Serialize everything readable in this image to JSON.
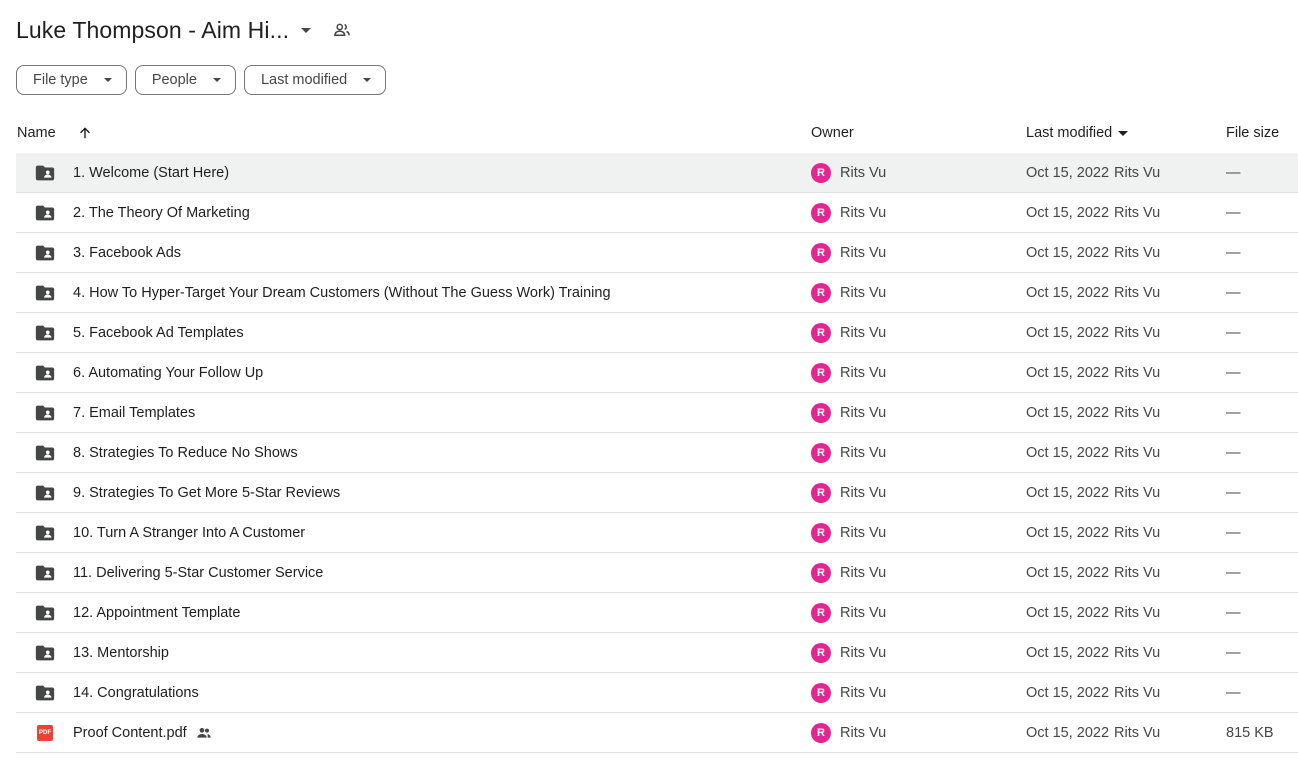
{
  "header": {
    "title": "Luke Thompson - Aim Hi..."
  },
  "filters": [
    {
      "label": "File type"
    },
    {
      "label": "People"
    },
    {
      "label": "Last modified"
    }
  ],
  "columns": {
    "name": "Name",
    "owner": "Owner",
    "last_modified": "Last modified",
    "file_size": "File size"
  },
  "rows": [
    {
      "name": "1. Welcome (Start Here)",
      "type": "folder",
      "owner_initial": "R",
      "owner": "Rits Vu",
      "date": "Oct 15, 2022",
      "modified_by": "Rits Vu",
      "size": "—",
      "selected": true
    },
    {
      "name": "2. The Theory Of Marketing",
      "type": "folder",
      "owner_initial": "R",
      "owner": "Rits Vu",
      "date": "Oct 15, 2022",
      "modified_by": "Rits Vu",
      "size": "—"
    },
    {
      "name": "3. Facebook Ads",
      "type": "folder",
      "owner_initial": "R",
      "owner": "Rits Vu",
      "date": "Oct 15, 2022",
      "modified_by": "Rits Vu",
      "size": "—"
    },
    {
      "name": "4. How To Hyper-Target Your Dream Customers (Without The Guess Work) Training",
      "type": "folder",
      "owner_initial": "R",
      "owner": "Rits Vu",
      "date": "Oct 15, 2022",
      "modified_by": "Rits Vu",
      "size": "—"
    },
    {
      "name": "5. Facebook Ad Templates",
      "type": "folder",
      "owner_initial": "R",
      "owner": "Rits Vu",
      "date": "Oct 15, 2022",
      "modified_by": "Rits Vu",
      "size": "—"
    },
    {
      "name": "6. Automating Your Follow Up",
      "type": "folder",
      "owner_initial": "R",
      "owner": "Rits Vu",
      "date": "Oct 15, 2022",
      "modified_by": "Rits Vu",
      "size": "—"
    },
    {
      "name": "7. Email Templates",
      "type": "folder",
      "owner_initial": "R",
      "owner": "Rits Vu",
      "date": "Oct 15, 2022",
      "modified_by": "Rits Vu",
      "size": "—"
    },
    {
      "name": "8. Strategies To Reduce No Shows",
      "type": "folder",
      "owner_initial": "R",
      "owner": "Rits Vu",
      "date": "Oct 15, 2022",
      "modified_by": "Rits Vu",
      "size": "—"
    },
    {
      "name": "9. Strategies To Get More 5-Star Reviews",
      "type": "folder",
      "owner_initial": "R",
      "owner": "Rits Vu",
      "date": "Oct 15, 2022",
      "modified_by": "Rits Vu",
      "size": "—"
    },
    {
      "name": "10. Turn A Stranger Into A Customer",
      "type": "folder",
      "owner_initial": "R",
      "owner": "Rits Vu",
      "date": "Oct 15, 2022",
      "modified_by": "Rits Vu",
      "size": "—"
    },
    {
      "name": "11. Delivering 5-Star Customer Service",
      "type": "folder",
      "owner_initial": "R",
      "owner": "Rits Vu",
      "date": "Oct 15, 2022",
      "modified_by": "Rits Vu",
      "size": "—"
    },
    {
      "name": "12. Appointment Template",
      "type": "folder",
      "owner_initial": "R",
      "owner": "Rits Vu",
      "date": "Oct 15, 2022",
      "modified_by": "Rits Vu",
      "size": "—"
    },
    {
      "name": "13. Mentorship",
      "type": "folder",
      "owner_initial": "R",
      "owner": "Rits Vu",
      "date": "Oct 15, 2022",
      "modified_by": "Rits Vu",
      "size": "—"
    },
    {
      "name": "14. Congratulations",
      "type": "folder",
      "owner_initial": "R",
      "owner": "Rits Vu",
      "date": "Oct 15, 2022",
      "modified_by": "Rits Vu",
      "size": "—"
    },
    {
      "name": "Proof Content.pdf",
      "type": "pdf",
      "shared": true,
      "owner_initial": "R",
      "owner": "Rits Vu",
      "date": "Oct 15, 2022",
      "modified_by": "Rits Vu",
      "size": "815 KB"
    }
  ],
  "icons": {
    "folder": "shared-folder-icon",
    "pdf": "pdf-icon",
    "people": "people-icon",
    "sort": "arrow-up-icon"
  },
  "pdf_badge": "PDF",
  "colors": {
    "avatar": "#e52592",
    "folder_icon": "#444746",
    "pdf": "#ea4335",
    "selected_row": "#f0f1f1"
  }
}
